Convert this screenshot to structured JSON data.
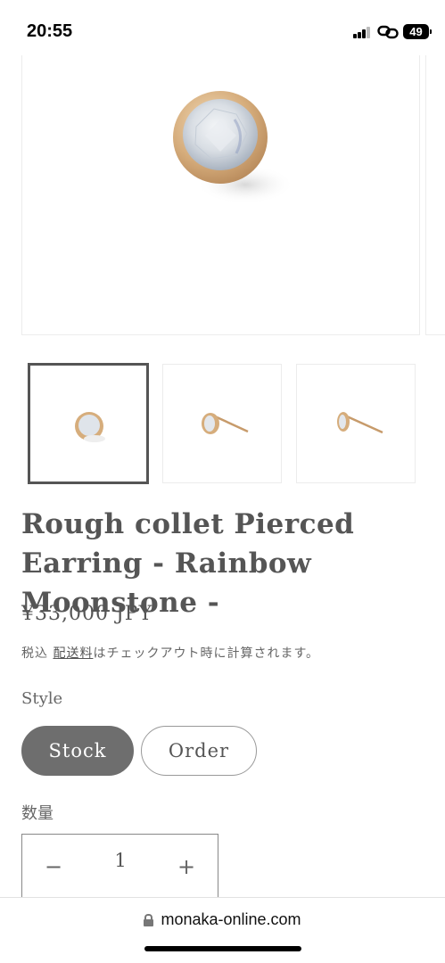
{
  "status_bar": {
    "time": "20:55",
    "battery": "49"
  },
  "gallery": {
    "main_image_alt": "Rough collet pierced earring, rainbow moonstone, front view",
    "thumbnails": [
      "front view",
      "side view",
      "angled view"
    ]
  },
  "product": {
    "title": "Rough collet Pierced Earring - Rainbow Moonstone -",
    "price": "¥33,000 JPY",
    "tax_prefix": "税込 ",
    "shipping_link": "配送料",
    "tax_suffix": "はチェックアウト時に計算されます。"
  },
  "style_option": {
    "label": "Style",
    "options": [
      "Stock",
      "Order"
    ],
    "selected": "Stock"
  },
  "quantity": {
    "label": "数量",
    "value": "1",
    "minus": "−",
    "plus": "+"
  },
  "browser": {
    "url": "monaka-online.com"
  }
}
